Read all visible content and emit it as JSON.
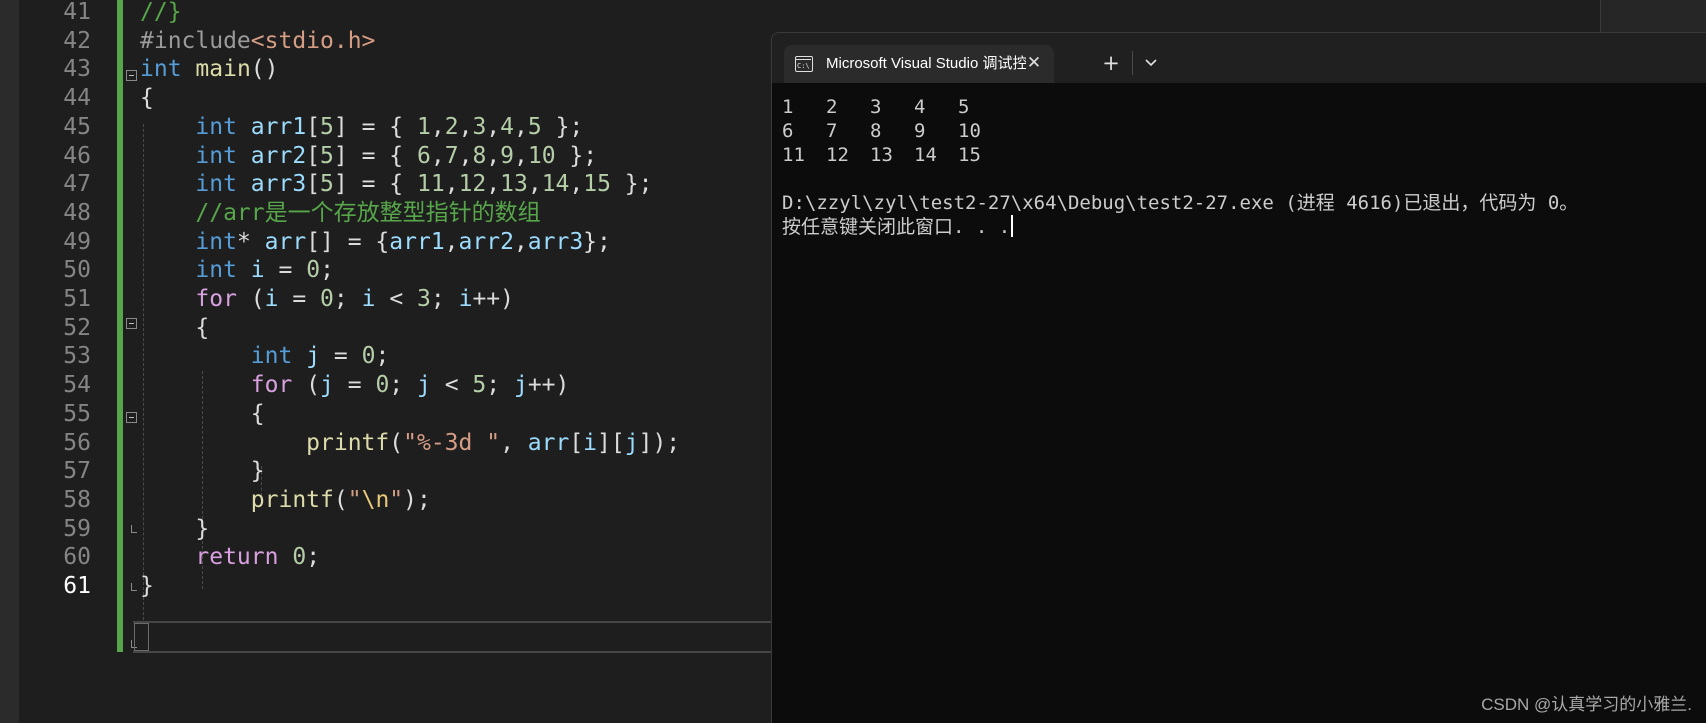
{
  "editor": {
    "line_numbers": [
      "41",
      "42",
      "43",
      "44",
      "45",
      "46",
      "47",
      "48",
      "49",
      "50",
      "51",
      "52",
      "53",
      "54",
      "55",
      "56",
      "57",
      "58",
      "59",
      "60",
      "61"
    ],
    "current_line": "61",
    "lines": [
      [
        {
          "c": "cmt",
          "t": "//}"
        }
      ],
      [
        {
          "c": "pp",
          "t": "#include"
        },
        {
          "c": "inc",
          "t": "<stdio.h>"
        }
      ],
      [
        {
          "c": "kw",
          "t": "int"
        },
        {
          "c": "",
          "t": " "
        },
        {
          "c": "fn",
          "t": "main"
        },
        {
          "c": "",
          "t": "()"
        }
      ],
      [
        {
          "c": "",
          "t": "{"
        }
      ],
      [
        {
          "c": "",
          "t": "    "
        },
        {
          "c": "kw",
          "t": "int"
        },
        {
          "c": "",
          "t": " "
        },
        {
          "c": "var",
          "t": "arr1"
        },
        {
          "c": "",
          "t": "["
        },
        {
          "c": "num",
          "t": "5"
        },
        {
          "c": "",
          "t": "] = { "
        },
        {
          "c": "num",
          "t": "1"
        },
        {
          "c": "",
          "t": ","
        },
        {
          "c": "num",
          "t": "2"
        },
        {
          "c": "",
          "t": ","
        },
        {
          "c": "num",
          "t": "3"
        },
        {
          "c": "",
          "t": ","
        },
        {
          "c": "num",
          "t": "4"
        },
        {
          "c": "",
          "t": ","
        },
        {
          "c": "num",
          "t": "5"
        },
        {
          "c": "",
          "t": " };"
        }
      ],
      [
        {
          "c": "",
          "t": "    "
        },
        {
          "c": "kw",
          "t": "int"
        },
        {
          "c": "",
          "t": " "
        },
        {
          "c": "var",
          "t": "arr2"
        },
        {
          "c": "",
          "t": "["
        },
        {
          "c": "num",
          "t": "5"
        },
        {
          "c": "",
          "t": "] = { "
        },
        {
          "c": "num",
          "t": "6"
        },
        {
          "c": "",
          "t": ","
        },
        {
          "c": "num",
          "t": "7"
        },
        {
          "c": "",
          "t": ","
        },
        {
          "c": "num",
          "t": "8"
        },
        {
          "c": "",
          "t": ","
        },
        {
          "c": "num",
          "t": "9"
        },
        {
          "c": "",
          "t": ","
        },
        {
          "c": "num",
          "t": "10"
        },
        {
          "c": "",
          "t": " };"
        }
      ],
      [
        {
          "c": "",
          "t": "    "
        },
        {
          "c": "kw",
          "t": "int"
        },
        {
          "c": "",
          "t": " "
        },
        {
          "c": "var",
          "t": "arr3"
        },
        {
          "c": "",
          "t": "["
        },
        {
          "c": "num",
          "t": "5"
        },
        {
          "c": "",
          "t": "] = { "
        },
        {
          "c": "num",
          "t": "11"
        },
        {
          "c": "",
          "t": ","
        },
        {
          "c": "num",
          "t": "12"
        },
        {
          "c": "",
          "t": ","
        },
        {
          "c": "num",
          "t": "13"
        },
        {
          "c": "",
          "t": ","
        },
        {
          "c": "num",
          "t": "14"
        },
        {
          "c": "",
          "t": ","
        },
        {
          "c": "num",
          "t": "15"
        },
        {
          "c": "",
          "t": " };"
        }
      ],
      [
        {
          "c": "",
          "t": "    "
        },
        {
          "c": "cmt",
          "t": "//arr是一个存放整型指针的数组"
        }
      ],
      [
        {
          "c": "",
          "t": "    "
        },
        {
          "c": "kw",
          "t": "int"
        },
        {
          "c": "",
          "t": "* "
        },
        {
          "c": "var",
          "t": "arr"
        },
        {
          "c": "",
          "t": "[] = {"
        },
        {
          "c": "var",
          "t": "arr1"
        },
        {
          "c": "",
          "t": ","
        },
        {
          "c": "var",
          "t": "arr2"
        },
        {
          "c": "",
          "t": ","
        },
        {
          "c": "var",
          "t": "arr3"
        },
        {
          "c": "",
          "t": "};"
        }
      ],
      [
        {
          "c": "",
          "t": "    "
        },
        {
          "c": "kw",
          "t": "int"
        },
        {
          "c": "",
          "t": " "
        },
        {
          "c": "var",
          "t": "i"
        },
        {
          "c": "",
          "t": " = "
        },
        {
          "c": "num",
          "t": "0"
        },
        {
          "c": "",
          "t": ";"
        }
      ],
      [
        {
          "c": "",
          "t": "    "
        },
        {
          "c": "ctl",
          "t": "for"
        },
        {
          "c": "",
          "t": " ("
        },
        {
          "c": "var",
          "t": "i"
        },
        {
          "c": "",
          "t": " = "
        },
        {
          "c": "num",
          "t": "0"
        },
        {
          "c": "",
          "t": "; "
        },
        {
          "c": "var",
          "t": "i"
        },
        {
          "c": "",
          "t": " < "
        },
        {
          "c": "num",
          "t": "3"
        },
        {
          "c": "",
          "t": "; "
        },
        {
          "c": "var",
          "t": "i"
        },
        {
          "c": "",
          "t": "++)"
        }
      ],
      [
        {
          "c": "",
          "t": "    {"
        }
      ],
      [
        {
          "c": "",
          "t": "        "
        },
        {
          "c": "kw",
          "t": "int"
        },
        {
          "c": "",
          "t": " "
        },
        {
          "c": "var",
          "t": "j"
        },
        {
          "c": "",
          "t": " = "
        },
        {
          "c": "num",
          "t": "0"
        },
        {
          "c": "",
          "t": ";"
        }
      ],
      [
        {
          "c": "",
          "t": "        "
        },
        {
          "c": "ctl",
          "t": "for"
        },
        {
          "c": "",
          "t": " ("
        },
        {
          "c": "var",
          "t": "j"
        },
        {
          "c": "",
          "t": " = "
        },
        {
          "c": "num",
          "t": "0"
        },
        {
          "c": "",
          "t": "; "
        },
        {
          "c": "var",
          "t": "j"
        },
        {
          "c": "",
          "t": " < "
        },
        {
          "c": "num",
          "t": "5"
        },
        {
          "c": "",
          "t": "; "
        },
        {
          "c": "var",
          "t": "j"
        },
        {
          "c": "",
          "t": "++)"
        }
      ],
      [
        {
          "c": "",
          "t": "        {"
        }
      ],
      [
        {
          "c": "",
          "t": "            "
        },
        {
          "c": "fn",
          "t": "printf"
        },
        {
          "c": "",
          "t": "("
        },
        {
          "c": "str",
          "t": "\"%-3d \""
        },
        {
          "c": "",
          "t": ", "
        },
        {
          "c": "var",
          "t": "arr"
        },
        {
          "c": "",
          "t": "["
        },
        {
          "c": "var",
          "t": "i"
        },
        {
          "c": "",
          "t": "]["
        },
        {
          "c": "var",
          "t": "j"
        },
        {
          "c": "",
          "t": "]);"
        }
      ],
      [
        {
          "c": "",
          "t": "        }"
        }
      ],
      [
        {
          "c": "",
          "t": "        "
        },
        {
          "c": "fn",
          "t": "printf"
        },
        {
          "c": "",
          "t": "("
        },
        {
          "c": "str",
          "t": "\""
        },
        {
          "c": "esc",
          "t": "\\n"
        },
        {
          "c": "str",
          "t": "\""
        },
        {
          "c": "",
          "t": ");"
        }
      ],
      [
        {
          "c": "",
          "t": "    }"
        }
      ],
      [
        {
          "c": "",
          "t": "    "
        },
        {
          "c": "ctl",
          "t": "return"
        },
        {
          "c": "",
          "t": " "
        },
        {
          "c": "num",
          "t": "0"
        },
        {
          "c": "",
          "t": ";"
        }
      ],
      [
        {
          "c": "",
          "t": "}"
        }
      ]
    ]
  },
  "terminal": {
    "tab_title": "Microsoft Visual Studio 调试控",
    "tab_icon_text": "C:\\",
    "close_icon": "close-icon",
    "new_tab_label": "+",
    "dropdown_label": "⌵",
    "output_rows": [
      [
        "1",
        "2",
        "3",
        "4",
        "5"
      ],
      [
        "6",
        "7",
        "8",
        "9",
        "10"
      ],
      [
        "11",
        "12",
        "13",
        "14",
        "15"
      ]
    ],
    "exit_message": "D:\\zzyl\\zyl\\test2-27\\x64\\Debug\\test2-27.exe (进程 4616)已退出，代码为 0。",
    "prompt_message": "按任意键关闭此窗口. . ."
  },
  "watermark": "CSDN @认真学习的小雅兰."
}
